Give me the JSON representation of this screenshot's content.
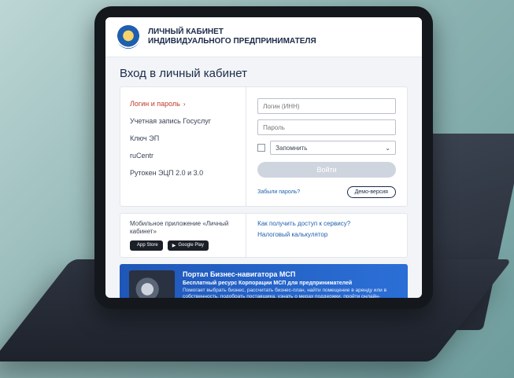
{
  "header": {
    "title_line1": "Личный кабинет",
    "title_line2": "индивидуального предпринимателя"
  },
  "page_title": "Вход в личный кабинет",
  "methods": [
    {
      "label": "Логин и пароль",
      "active": true
    },
    {
      "label": "Учетная запись Госуслуг",
      "active": false
    },
    {
      "label": "Ключ ЭП",
      "active": false
    },
    {
      "label": "ruCentr",
      "active": false
    },
    {
      "label": "Рутокен ЭЦП 2.0 и 3.0",
      "active": false
    }
  ],
  "form": {
    "login_placeholder": "Логин (ИНН)",
    "password_placeholder": "Пароль",
    "remember_label": "Запомнить",
    "login_button": "Войти",
    "forgot_link": "Забыли пароль?",
    "demo_button": "Демо-версия"
  },
  "mobile": {
    "title": "Мобильное приложение «Личный кабинет»",
    "app_store": "App Store",
    "google_play": "Google Play"
  },
  "links": {
    "access": "Как получить доступ к сервису?",
    "calculator": "Налоговый калькулятор"
  },
  "banner": {
    "title": "Портал Бизнес-навигатора МСП",
    "subtitle": "Бесплатный ресурс Корпорации МСП для предпринимателей",
    "text": "Помогает выбрать бизнес, рассчитать бизнес-план, найти помещение в аренду или в собственность, подобрать поставщика, узнать о мерах поддержки, пройти онлайн-обучение и подать заявку на кредит."
  }
}
